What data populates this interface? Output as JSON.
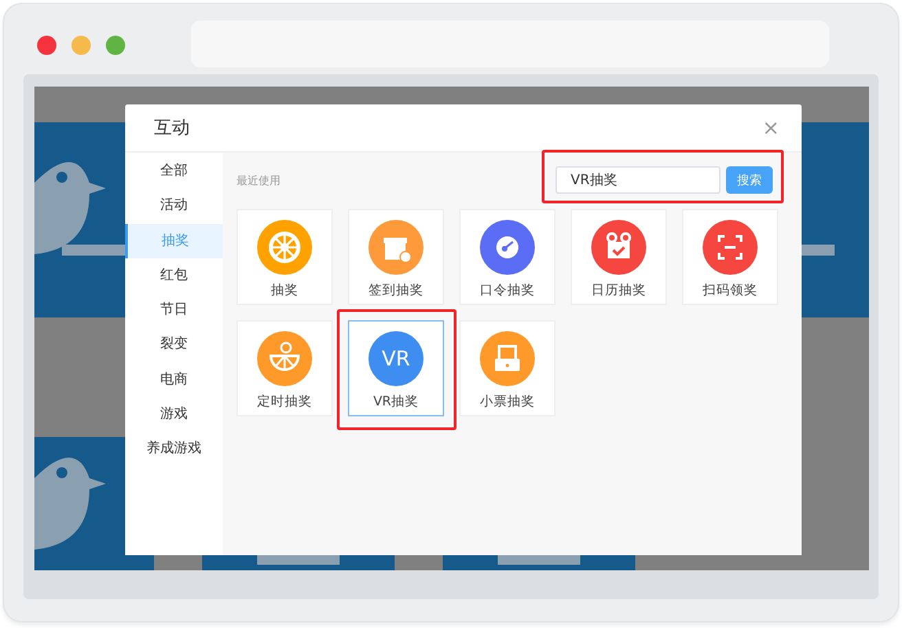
{
  "dialog": {
    "title": "互动",
    "close": "×"
  },
  "sidebar": {
    "items": [
      {
        "label": "全部",
        "selected": false
      },
      {
        "label": "活动",
        "selected": false
      },
      {
        "label": "抽奖",
        "selected": true
      },
      {
        "label": "红包",
        "selected": false
      },
      {
        "label": "节日",
        "selected": false
      },
      {
        "label": "裂变",
        "selected": false
      },
      {
        "label": "电商",
        "selected": false
      },
      {
        "label": "游戏",
        "selected": false
      },
      {
        "label": "养成游戏",
        "selected": false
      }
    ]
  },
  "section_label": "最近使用",
  "search": {
    "value": "VR抽奖",
    "button": "搜索",
    "highlighted": true
  },
  "cards": [
    {
      "label": "抽奖",
      "kind": "wheel",
      "color": "#ffa200",
      "selected": false,
      "highlighted": false
    },
    {
      "label": "签到抽奖",
      "kind": "gift",
      "color": "#ff9a3c",
      "selected": false,
      "highlighted": false
    },
    {
      "label": "口令抽奖",
      "kind": "key",
      "color": "#5b6cf5",
      "selected": false,
      "highlighted": false
    },
    {
      "label": "日历抽奖",
      "kind": "calendar",
      "color": "#f5473f",
      "selected": false,
      "highlighted": false
    },
    {
      "label": "扫码领奖",
      "kind": "scan",
      "color": "#f5473f",
      "selected": false,
      "highlighted": false
    },
    {
      "label": "定时抽奖",
      "kind": "timer",
      "color": "#ff9a2a",
      "selected": false,
      "highlighted": false
    },
    {
      "label": "VR抽奖",
      "kind": "vr",
      "icon_text": "VR",
      "color": "#3d8ef0",
      "selected": true,
      "highlighted": true
    },
    {
      "label": "小票抽奖",
      "kind": "receipt",
      "color": "#ff9a2a",
      "selected": false,
      "highlighted": false
    }
  ]
}
